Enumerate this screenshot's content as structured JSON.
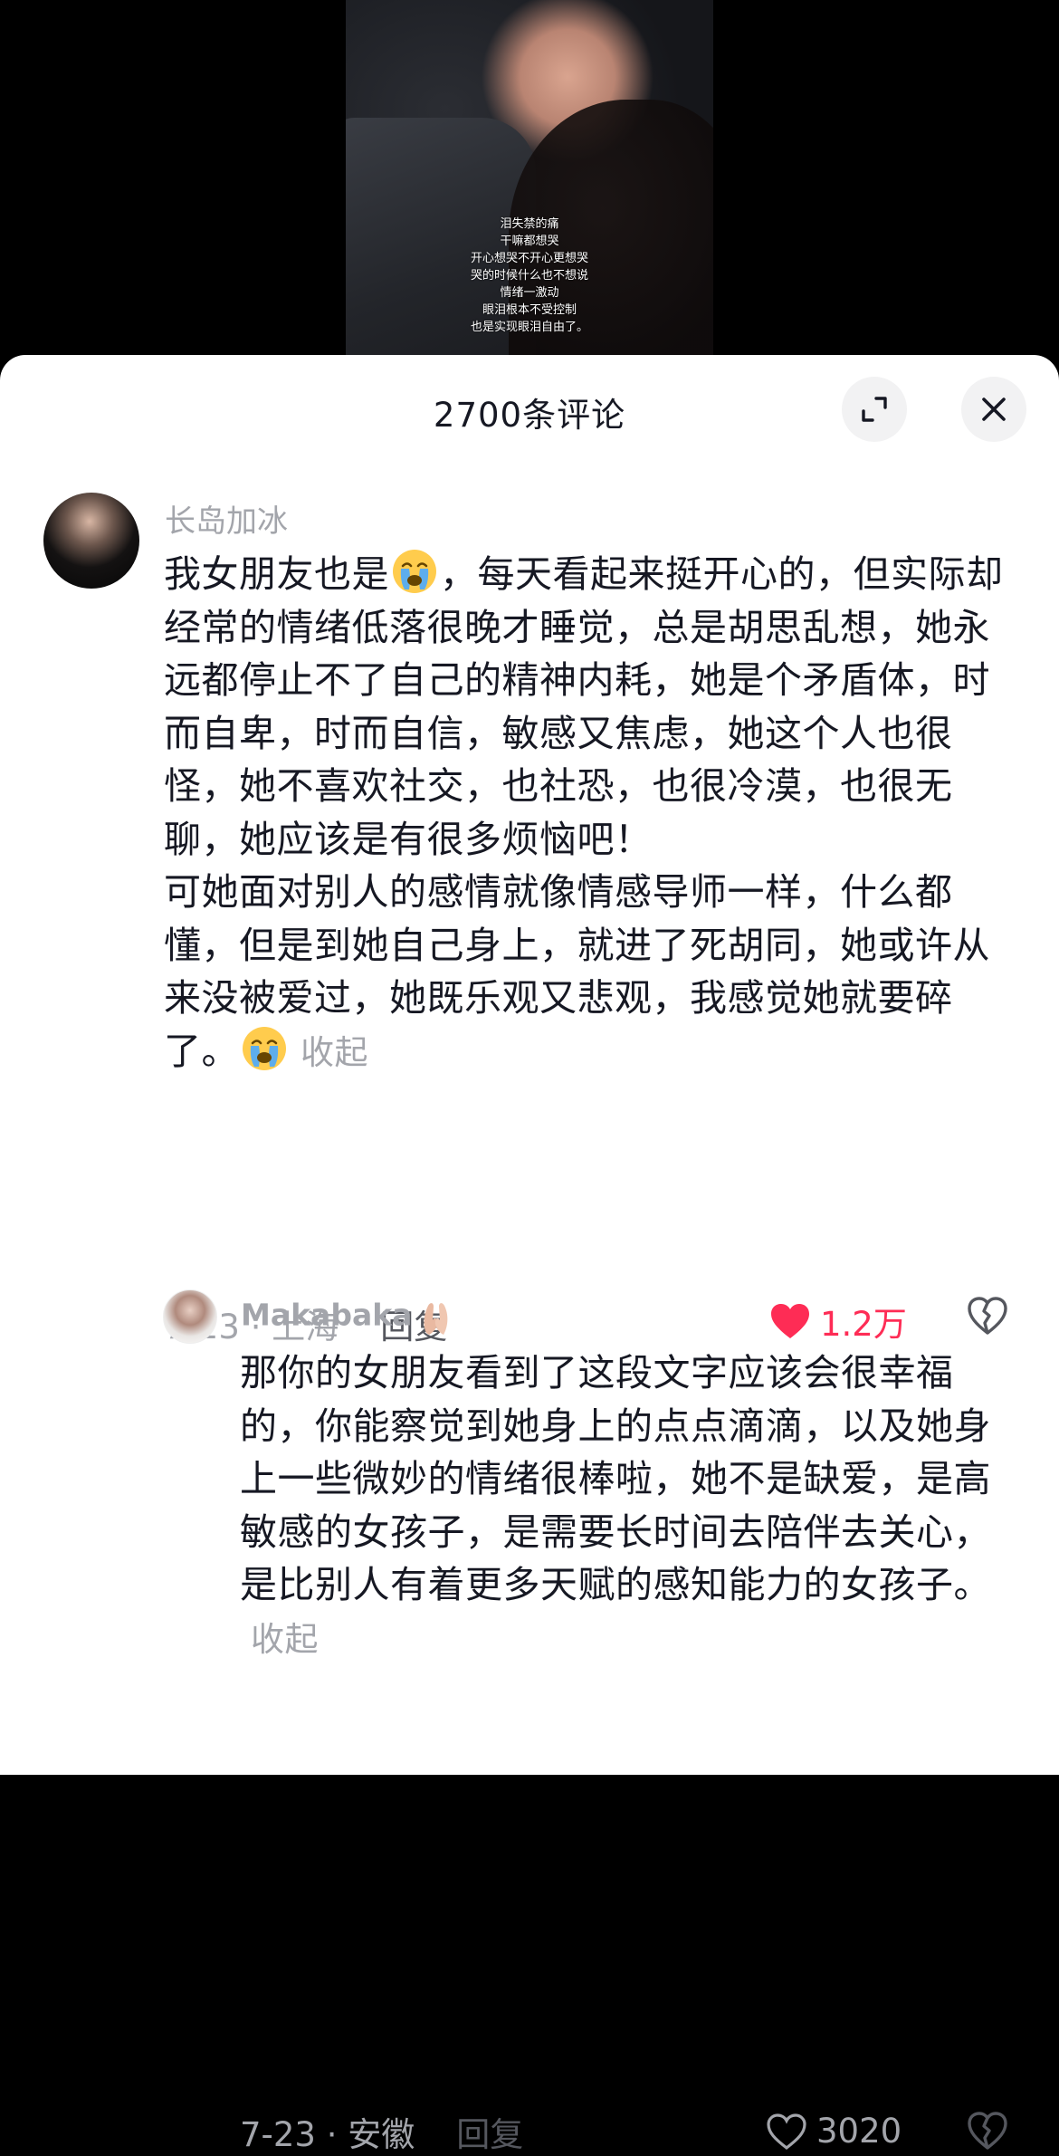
{
  "video": {
    "caption_lines": [
      "泪失禁的痛",
      "干嘛都想哭",
      "开心想哭不开心更想哭",
      "哭的时候什么也不想说",
      "情绪一激动",
      "眼泪根本不受控制",
      "也是实现眼泪自由了。"
    ]
  },
  "sheet": {
    "title": "2700条评论",
    "expand_icon": "expand-icon",
    "close_icon": "close-icon"
  },
  "comment": {
    "username": "长岛加冰",
    "text_1a": "我女朋友也是",
    "text_1b": "，每天看起来挺开心的，但实际却经常的情绪低落很晚才睡觉，总是胡思乱想，她永远都停止不了自己的精神内耗，她是个矛盾体，时而自卑，时而自信，敏感又焦虑，她这个人也很怪，她不喜欢社交，也社恐，也很冷漠，也很无聊，她应该是有很多烦恼吧！",
    "text_2": "可她面对别人的感情就像情感导师一样，什么都懂，但是到她自己身上，就进了死胡同，她或许从来没被爱过，她既乐观又悲观，我感觉她就要碎了。",
    "emoji": "loudly-crying-face",
    "collapse_label": "收起",
    "date_location": "7-23 · 上海",
    "reply_label": "回复",
    "like_count": "1.2万",
    "like_color": "#fe2c55"
  },
  "reply": {
    "username": "Makabaka",
    "badge_icon": "hands-emoji-icon",
    "text": "那你的女朋友看到了这段文字应该会很幸福的，你能察觉到她身上的点点滴滴，以及她身上一些微妙的情绪很棒啦，她不是缺爱，是高敏感的女孩子，是需要长时间去陪伴去关心，是比别人有着更多天赋的感知能力的女孩子。",
    "collapse_label": "收起",
    "date_location": "7-23 · 安徽",
    "reply_label": "回复",
    "like_count": "3020"
  }
}
